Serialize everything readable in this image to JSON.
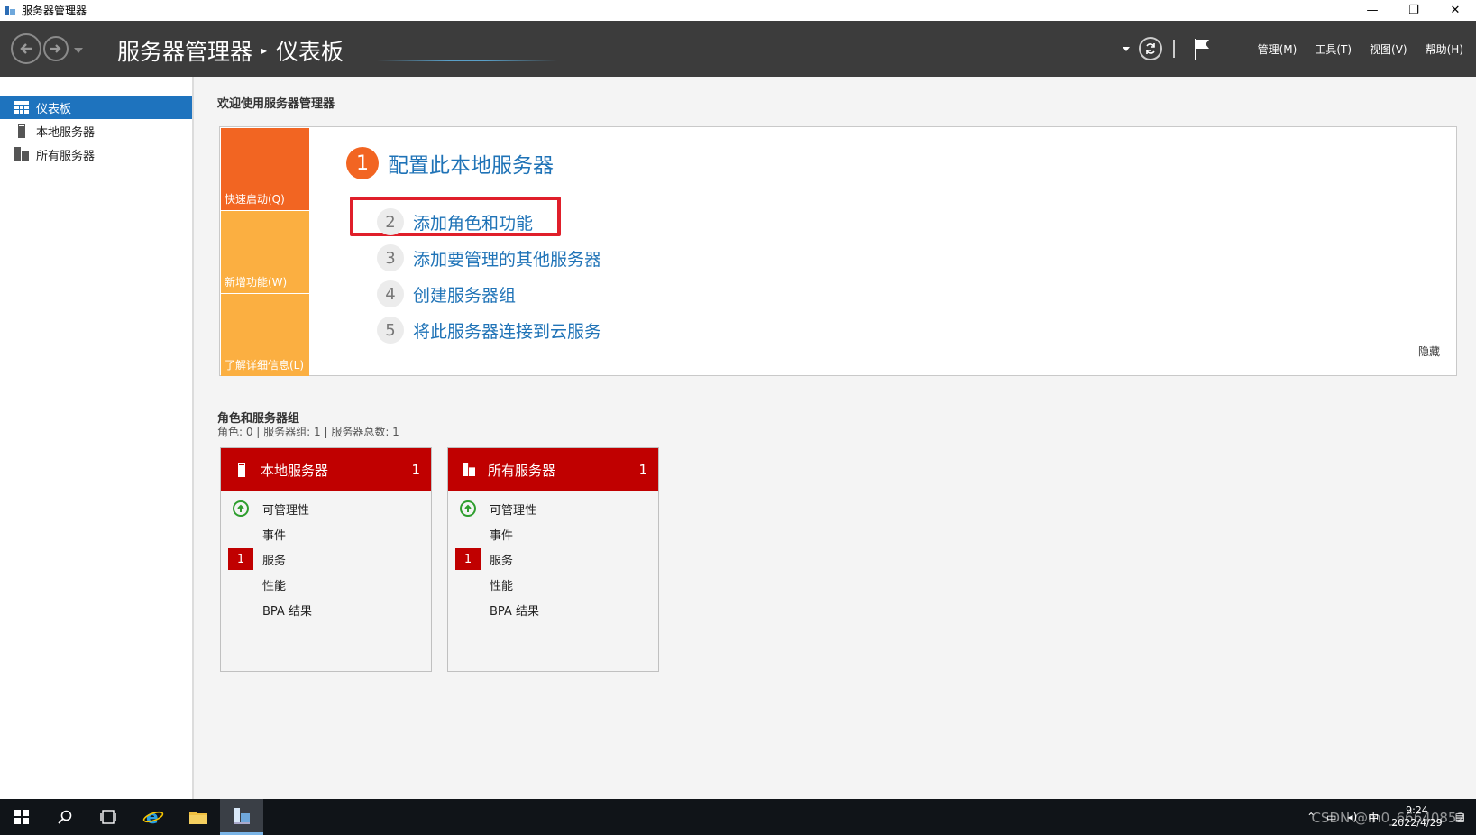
{
  "window": {
    "title": "服务器管理器",
    "controls": {
      "minimize": "—",
      "restore": "❐",
      "close": "✕"
    }
  },
  "header": {
    "breadcrumb_root": "服务器管理器",
    "breadcrumb_sep": "▸",
    "breadcrumb_page": "仪表板",
    "menus": [
      "管理(M)",
      "工具(T)",
      "视图(V)",
      "帮助(H)"
    ]
  },
  "sidebar": {
    "items": [
      {
        "label": "仪表板",
        "icon": "dashboard-icon",
        "active": true
      },
      {
        "label": "本地服务器",
        "icon": "server-icon",
        "active": false
      },
      {
        "label": "所有服务器",
        "icon": "servers-icon",
        "active": false
      }
    ]
  },
  "welcome": {
    "title": "欢迎使用服务器管理器",
    "tiles": [
      "快速启动(Q)",
      "新增功能(W)",
      "了解详细信息(L)"
    ],
    "step1": {
      "num": "1",
      "label": "配置此本地服务器"
    },
    "steps": [
      {
        "num": "2",
        "label": "添加角色和功能"
      },
      {
        "num": "3",
        "label": "添加要管理的其他服务器"
      },
      {
        "num": "4",
        "label": "创建服务器组"
      },
      {
        "num": "5",
        "label": "将此服务器连接到云服务"
      }
    ],
    "hide": "隐藏"
  },
  "roles": {
    "title": "角色和服务器组",
    "summary": "角色: 0 | 服务器组: 1 | 服务器总数: 1",
    "cards": [
      {
        "name": "本地服务器",
        "count": "1",
        "rows": [
          "可管理性",
          "事件",
          "服务",
          "性能",
          "BPA 结果"
        ],
        "service_badge": "1"
      },
      {
        "name": "所有服务器",
        "count": "1",
        "rows": [
          "可管理性",
          "事件",
          "服务",
          "性能",
          "BPA 结果"
        ],
        "service_badge": "1"
      }
    ]
  },
  "taskbar": {
    "time": "9:24",
    "date": "2022/4/29",
    "ime": "中",
    "watermark": "CSDN @m0_66640852"
  },
  "colors": {
    "header_bg": "#3c3c3c",
    "accent_blue": "#1e73be",
    "link_blue": "#1f73b7",
    "tile_orange": "#f26522",
    "tile_yellow": "#fbaf41",
    "card_red": "#c00000",
    "highlight_red": "#e01f2a"
  }
}
